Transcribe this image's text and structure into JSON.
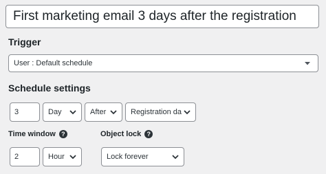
{
  "title_input": {
    "value": "First marketing email 3 days after the registration"
  },
  "trigger": {
    "label": "Trigger",
    "selected": "User : Default schedule"
  },
  "schedule": {
    "label": "Schedule settings",
    "amount": "3",
    "unit": "Day",
    "relation": "After",
    "event": "Registration date"
  },
  "time_window": {
    "label": "Time window",
    "help_glyph": "?",
    "amount": "2",
    "unit": "Hour"
  },
  "object_lock": {
    "label": "Object lock",
    "help_glyph": "?",
    "selected": "Lock forever"
  },
  "icons": {
    "help": "help-icon",
    "dropdown": "chevron-down-icon",
    "trigger_dropdown": "triangle-down-icon"
  },
  "colors": {
    "background": "#f0f0f1",
    "border": "#8c8f94",
    "text": "#1d2327"
  }
}
